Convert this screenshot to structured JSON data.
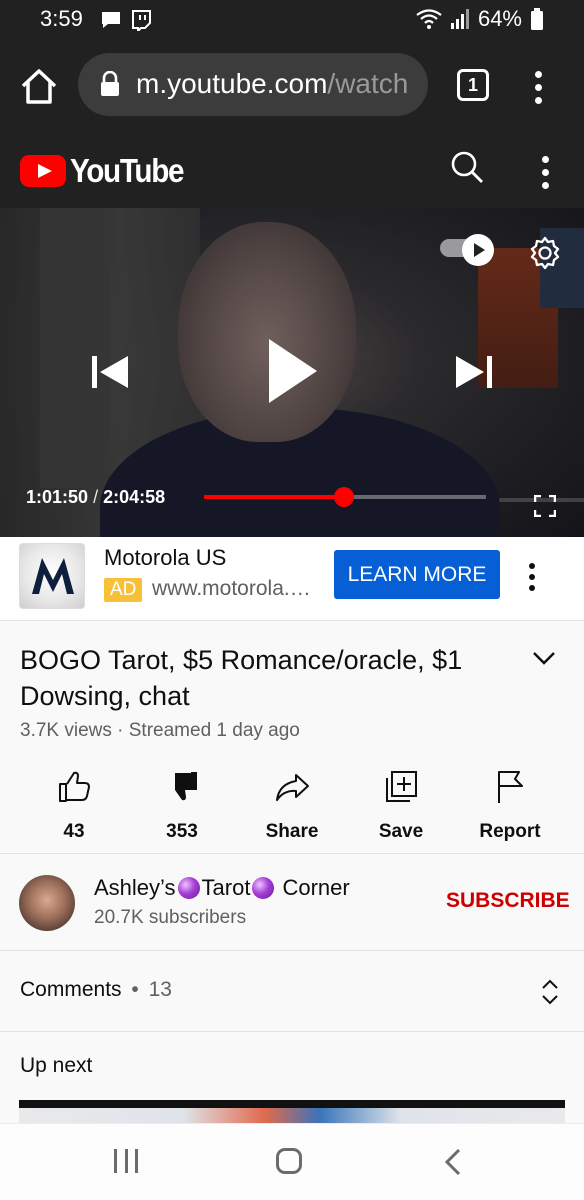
{
  "status_bar": {
    "time": "3:59",
    "battery": "64%"
  },
  "browser": {
    "url_host": "m.youtube.com",
    "url_path": "/watch",
    "tab_count": "1"
  },
  "youtube": {
    "logo_text": "YouTube"
  },
  "player": {
    "current_time": "1:01:50",
    "separator": "/",
    "duration": "2:04:58",
    "progress_fraction": 0.495
  },
  "ad": {
    "advertiser": "Motorola US",
    "badge": "AD",
    "url": "www.motorola.…",
    "cta": "LEARN MORE"
  },
  "video": {
    "title": "BOGO Tarot, $5 Romance/oracle, $1 Dowsing, chat",
    "meta": "3.7K views · Streamed 1 day ago"
  },
  "actions": [
    {
      "icon": "thumb-up-icon",
      "label": "43"
    },
    {
      "icon": "thumb-down-icon",
      "label": "353"
    },
    {
      "icon": "share-icon",
      "label": "Share"
    },
    {
      "icon": "save-icon",
      "label": "Save"
    },
    {
      "icon": "flag-icon",
      "label": "Report"
    }
  ],
  "channel": {
    "name_part1": "Ashley’s",
    "name_part2": "Tarot",
    "name_part3": "Corner",
    "subscribers": "20.7K subscribers",
    "subscribe_label": "SUBSCRIBE"
  },
  "comments": {
    "label": "Comments",
    "dot": "•",
    "count": "13"
  },
  "up_next": {
    "label": "Up next"
  },
  "colors": {
    "youtube_red": "#ff0000",
    "cta_blue": "#065fd4",
    "subscribe_red": "#cc0000",
    "ad_badge_yellow": "#f7c137"
  }
}
